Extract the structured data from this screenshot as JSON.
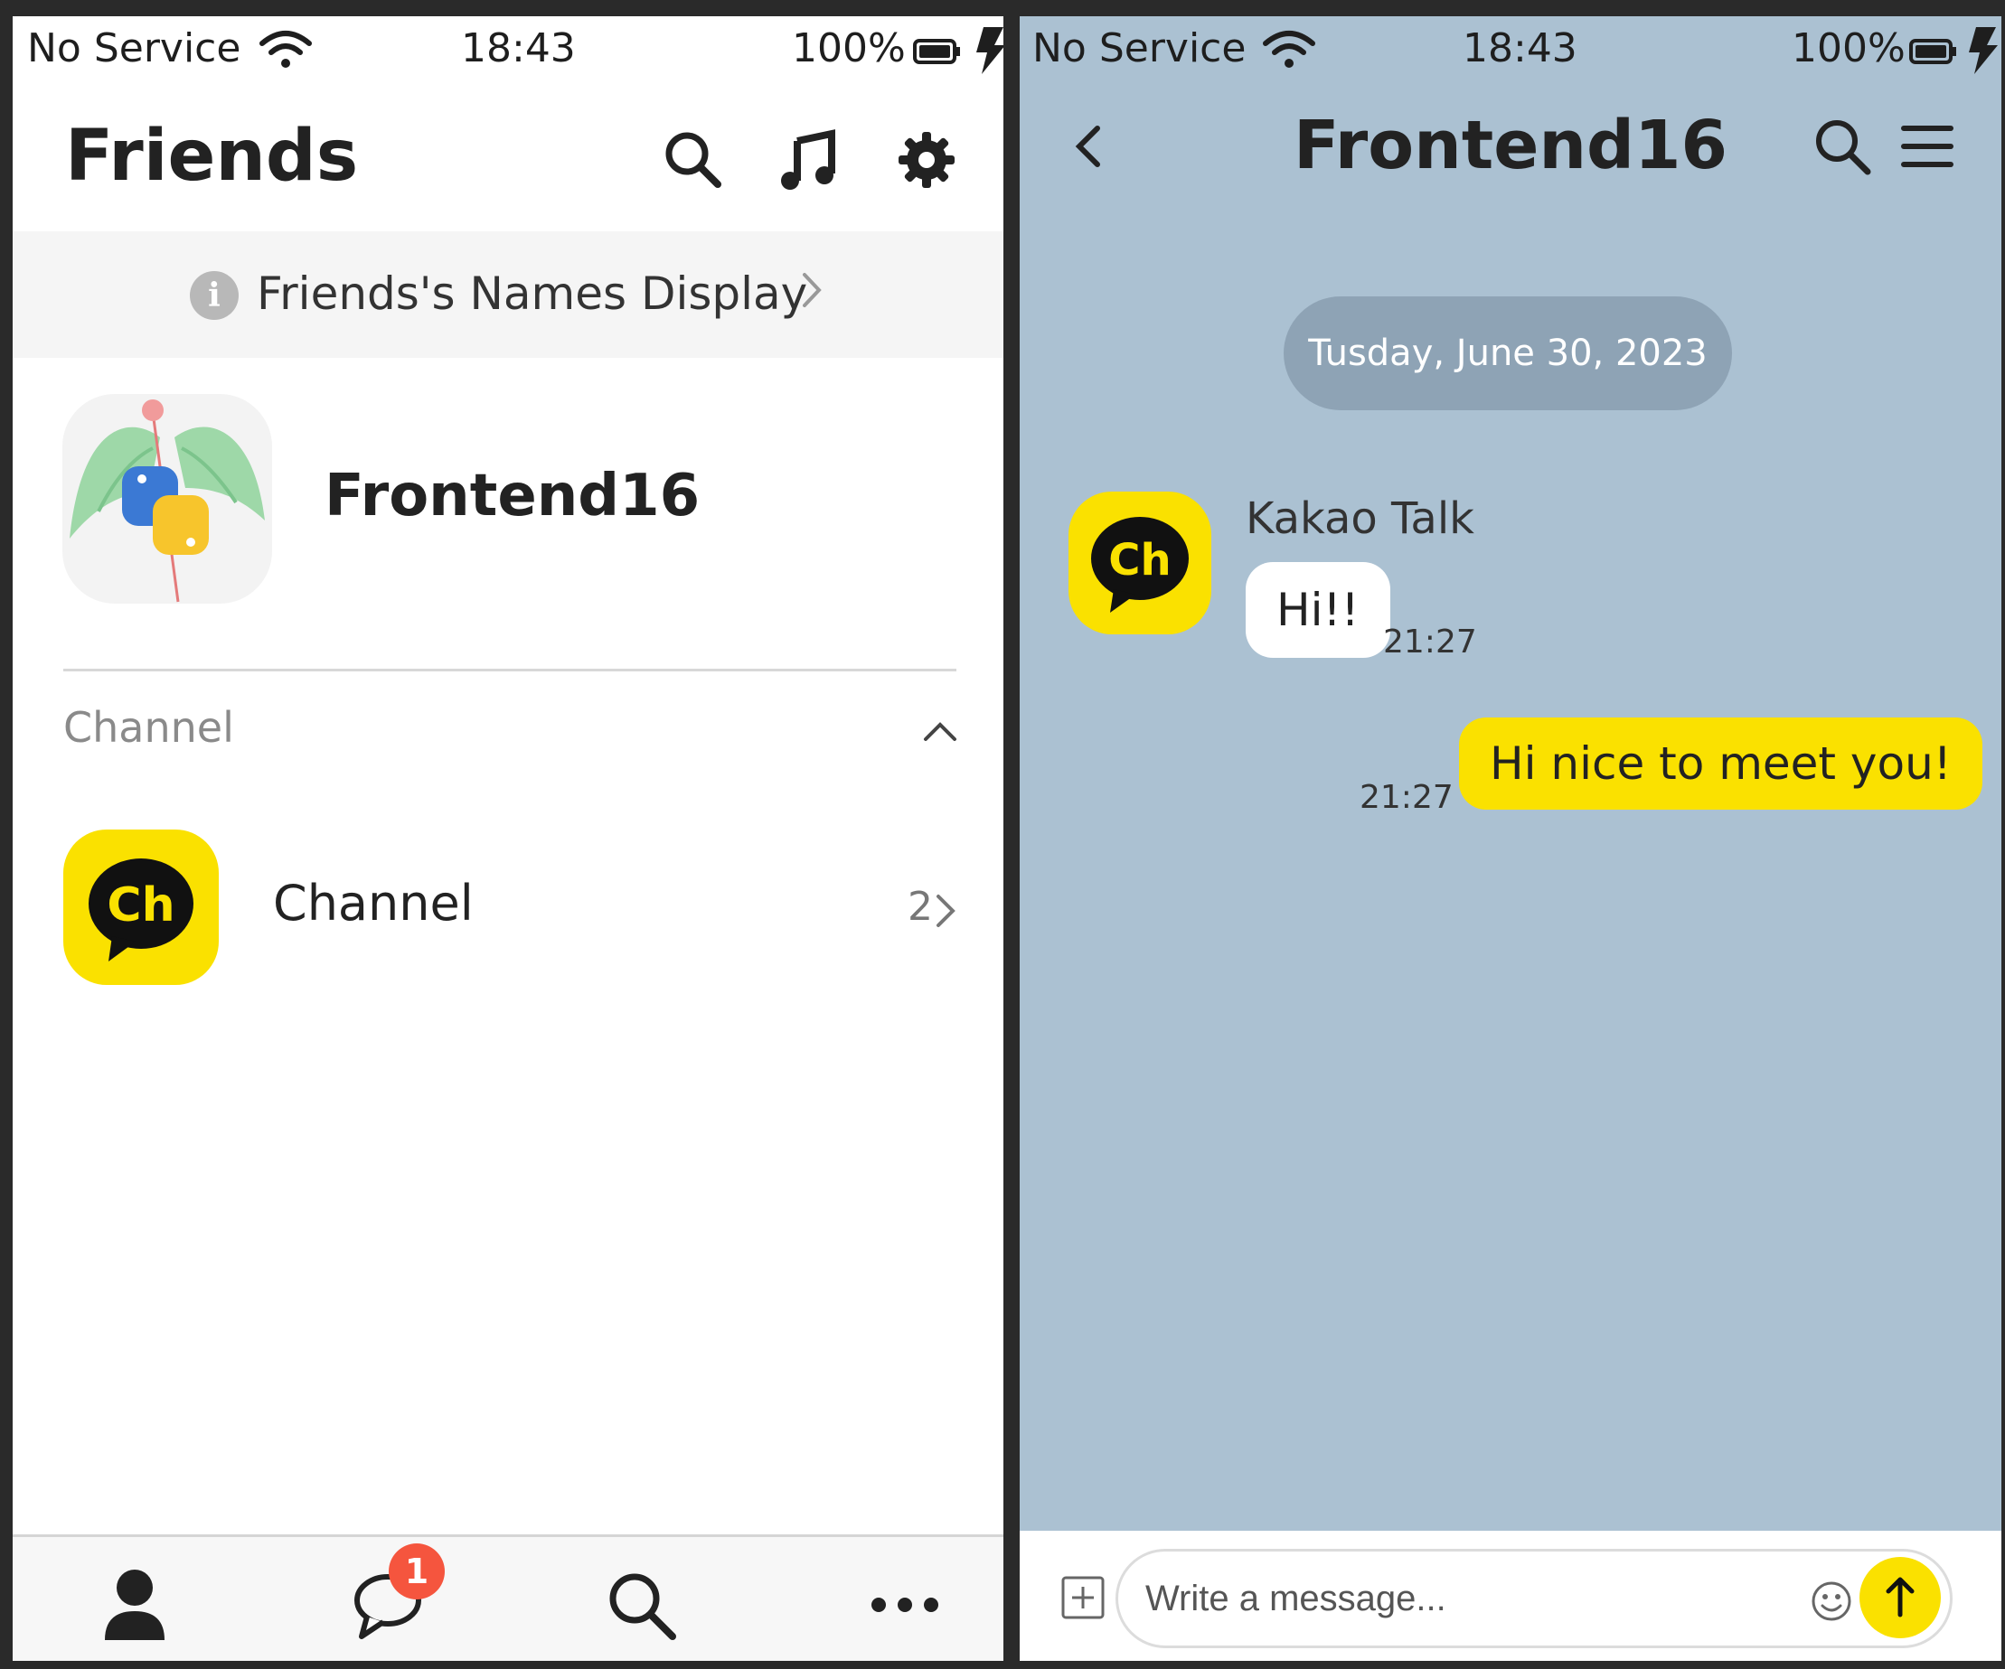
{
  "left_screen": {
    "status_bar": {
      "carrier": "No Service",
      "time": "18:43",
      "battery_percent": "100%"
    },
    "header": {
      "title": "Friends",
      "icons": [
        "search-icon",
        "music-icon",
        "settings-icon"
      ]
    },
    "names_banner": {
      "text": "Friends's Names Display",
      "icon": "info-icon"
    },
    "profile": {
      "name": "Frontend16"
    },
    "section": {
      "label": "Channel",
      "expanded": true
    },
    "channel_row": {
      "avatar_text": "Ch",
      "label": "Channel",
      "count": "2"
    },
    "tab_bar": {
      "tabs": [
        "friends-tab",
        "chats-tab",
        "search-tab",
        "more-tab"
      ],
      "chats_badge": "1"
    }
  },
  "right_screen": {
    "status_bar": {
      "carrier": "No Service",
      "time": "18:43",
      "battery_percent": "100%"
    },
    "header": {
      "title": "Frontend16"
    },
    "date_separator": "Tusday, June 30, 2023",
    "messages": [
      {
        "sender": "Kakao Talk",
        "avatar_text": "Ch",
        "text": "Hi!!",
        "time": "21:27",
        "direction": "incoming"
      },
      {
        "text": "Hi nice to meet you!",
        "time": "21:27",
        "direction": "outgoing"
      }
    ],
    "input": {
      "placeholder": "Write a message..."
    }
  },
  "colors": {
    "kakao_yellow": "#fae100",
    "chat_background": "#abc1d2",
    "badge_red": "#f5553e"
  }
}
